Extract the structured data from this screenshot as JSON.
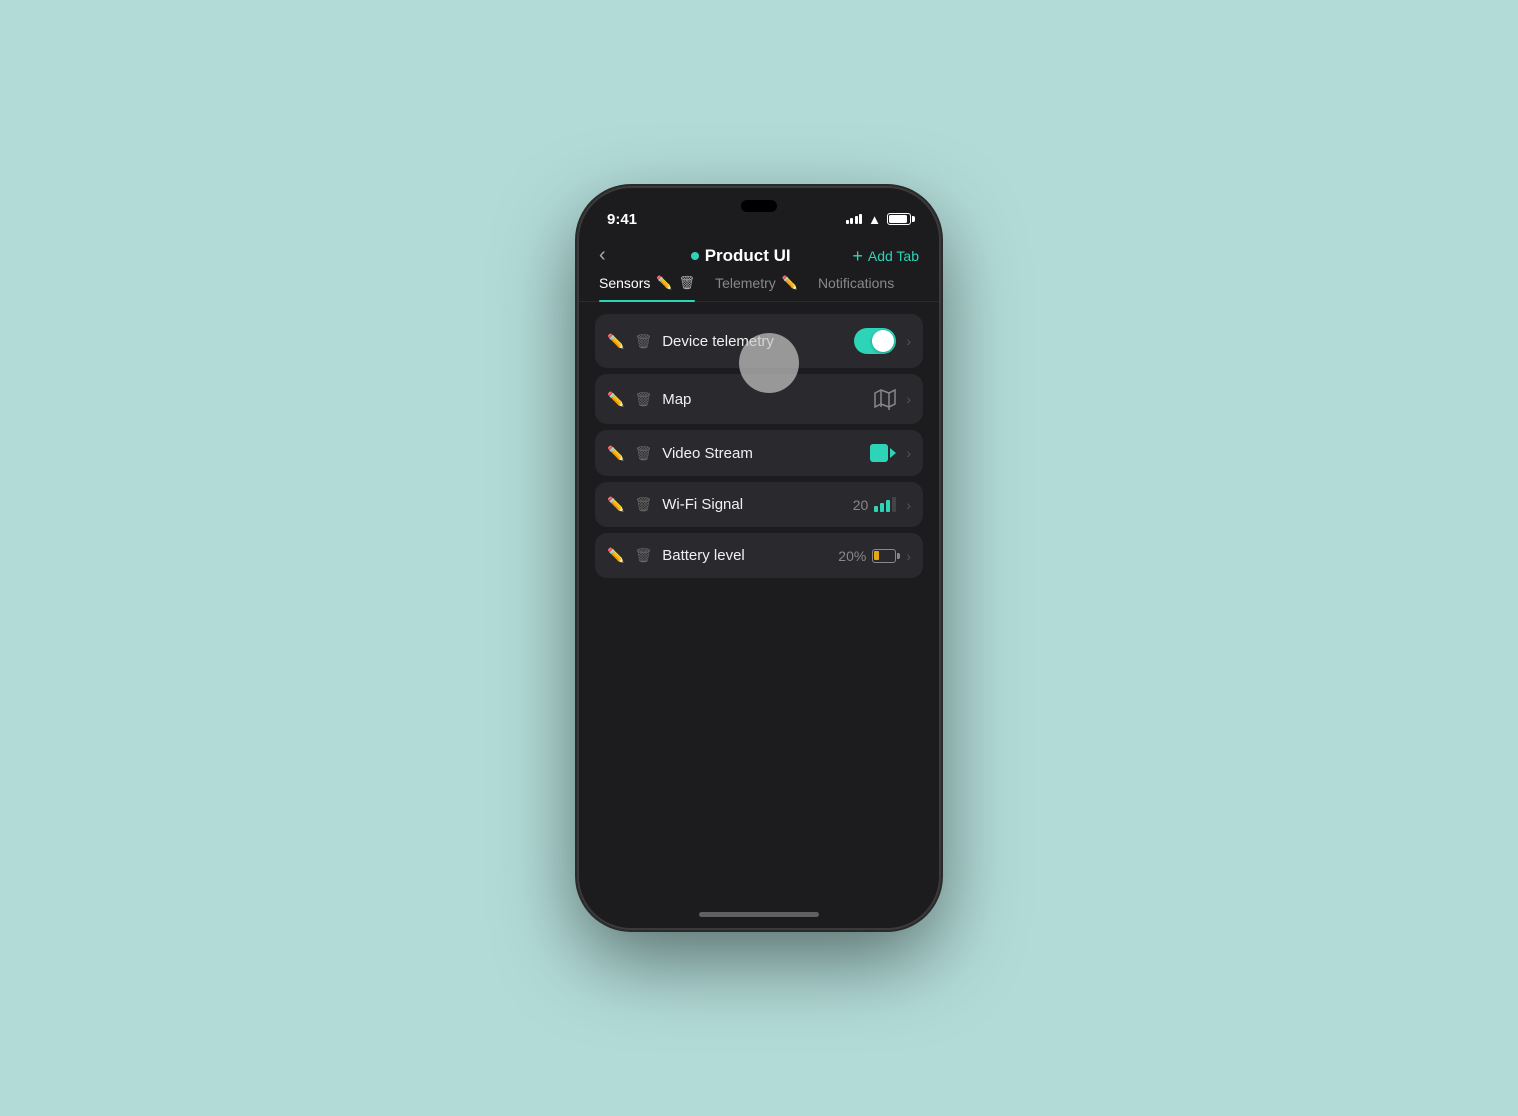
{
  "background": "#b2dbd8",
  "status_bar": {
    "time": "9:41",
    "signal_bars": [
      4,
      6,
      8,
      10,
      12
    ],
    "wifi": "wifi",
    "battery_full": true
  },
  "nav": {
    "back_label": "‹",
    "dot_color": "#2dd4b8",
    "title": "Product UI",
    "add_tab_label": "Add Tab"
  },
  "tabs": [
    {
      "id": "sensors",
      "label": "Sensors",
      "active": true,
      "has_edit": true,
      "has_delete": true
    },
    {
      "id": "telemetry",
      "label": "Telemetry",
      "active": false,
      "has_edit": true,
      "has_delete": false
    },
    {
      "id": "notifications",
      "label": "Notifications",
      "active": false,
      "has_edit": false,
      "has_delete": false
    }
  ],
  "items": [
    {
      "id": "device-telemetry",
      "label": "Device telemetry",
      "value_type": "toggle",
      "value": "on"
    },
    {
      "id": "map",
      "label": "Map",
      "value_type": "map",
      "value": ""
    },
    {
      "id": "video-stream",
      "label": "Video Stream",
      "value_type": "video",
      "value": ""
    },
    {
      "id": "wifi-signal",
      "label": "Wi-Fi Signal",
      "value_type": "signal",
      "value": "20"
    },
    {
      "id": "battery-level",
      "label": "Battery level",
      "value_type": "battery",
      "value": "20%"
    }
  ]
}
